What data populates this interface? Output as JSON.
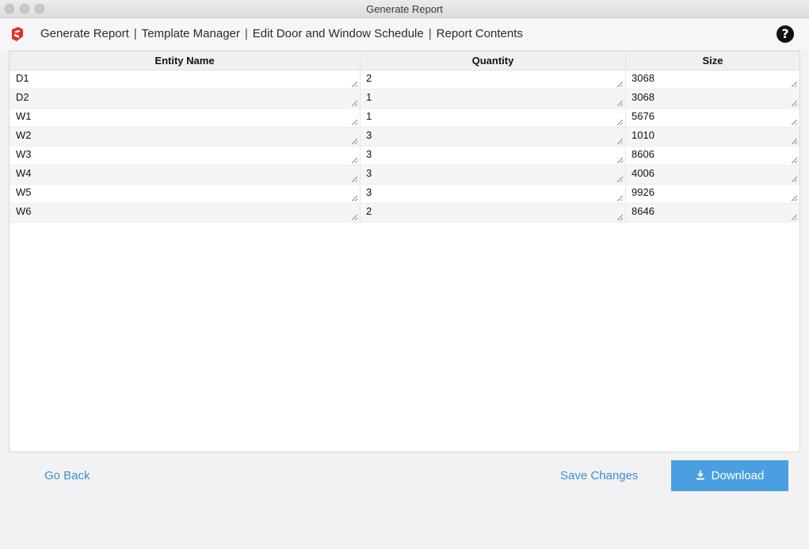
{
  "window": {
    "title": "Generate Report"
  },
  "toolbar": {
    "app_icon": "sketchup-logo-icon",
    "crumbs": [
      {
        "label": "Generate Report"
      },
      {
        "label": "Template Manager"
      },
      {
        "label": "Edit Door and Window Schedule"
      },
      {
        "label": "Report Contents"
      }
    ],
    "separator": "|",
    "help_icon": "question-circle-icon",
    "help_label": "?"
  },
  "table": {
    "columns": [
      "Entity Name",
      "Quantity",
      "Size"
    ],
    "rows": [
      {
        "entity": "D1",
        "quantity": "2",
        "size": "3068"
      },
      {
        "entity": "D2",
        "quantity": "1",
        "size": "3068"
      },
      {
        "entity": "W1",
        "quantity": "1",
        "size": "5676"
      },
      {
        "entity": "W2",
        "quantity": "3",
        "size": "1010"
      },
      {
        "entity": "W3",
        "quantity": "3",
        "size": "8606"
      },
      {
        "entity": "W4",
        "quantity": "3",
        "size": "4006"
      },
      {
        "entity": "W5",
        "quantity": "3",
        "size": "9926"
      },
      {
        "entity": "W6",
        "quantity": "2",
        "size": "8646"
      }
    ]
  },
  "actions": {
    "go_back": "Go Back",
    "save_changes": "Save Changes",
    "download": "Download",
    "download_icon": "download-icon"
  },
  "colors": {
    "accent": "#4a9fe0",
    "link": "#3b8fd0",
    "logo_red": "#e0302b"
  }
}
